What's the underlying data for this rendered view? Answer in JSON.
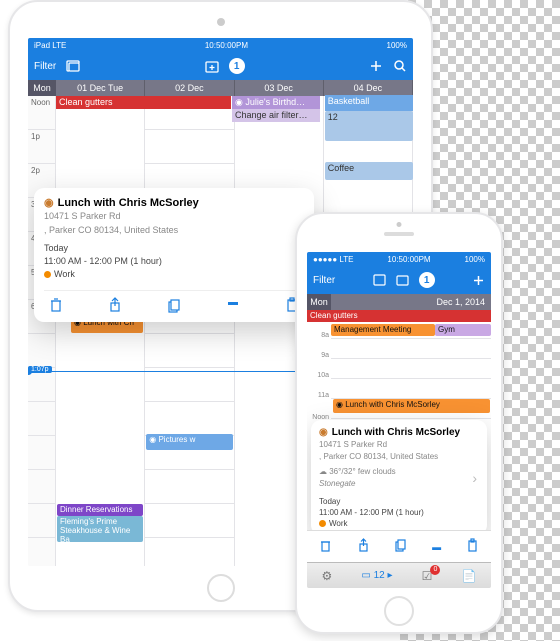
{
  "ipad": {
    "status": {
      "carrier": "iPad LTE",
      "time": "10:50:00PM",
      "battery": "100%"
    },
    "toolbar": {
      "filter": "Filter",
      "badge": "1"
    },
    "days": {
      "mon": "Mon",
      "cols": [
        "01 Dec Tue",
        "02 Dec",
        "03 Dec",
        "04 Dec"
      ]
    },
    "hours": [
      "Noon",
      "1p",
      "2p",
      "3p",
      "4p",
      "5p",
      "6p",
      "",
      "",
      "",
      "",
      "",
      "",
      "",
      ""
    ],
    "nowTime": "1:07p",
    "events": {
      "clean": "Clean gutters",
      "julie": "◉ Julie's Birthd…",
      "filter": "Change air filter…",
      "bball": "Basketball",
      "coffee": "Coffee",
      "lunch": "◉ Lunch with Ch",
      "pictures": "◉ Pictures w",
      "dinner": "Dinner Reservations",
      "fleming": "Fleming's Prime Steakhouse & Wine Ba"
    },
    "popover": {
      "icon": "◉",
      "title": "Lunch with Chris McSorley",
      "addr1": "10471 S Parker Rd",
      "addr2": ", Parker CO 80134, United States",
      "today": "Today",
      "time": "11:00 AM - 12:00 PM  (1 hour)",
      "calendar": "Work"
    }
  },
  "iphone": {
    "status": {
      "carrier": "●●●●● LTE",
      "time": "10:50:00PM",
      "battery": "100%"
    },
    "toolbar": {
      "filter": "Filter",
      "badge": "1"
    },
    "day": {
      "mon": "Mon",
      "date": "Dec 1, 2014"
    },
    "hours": [
      "8a",
      "9a",
      "10a",
      "11a",
      "Noon"
    ],
    "events": {
      "clean": "Clean gutters",
      "mgmt": "Management Meeting",
      "gym": "Gym",
      "lunch": "◉ Lunch with Chris McSorley"
    },
    "popover": {
      "icon": "◉",
      "title": "Lunch with Chris McSorley",
      "addr1": "10471 S Parker Rd",
      "addr2": ", Parker CO 80134, United States",
      "weather": "☁ 36°/32°  few clouds",
      "store": "Stonegate",
      "today": "Today",
      "time": "11:00 AM - 12:00 PM  (1 hour)",
      "calendar": "Work"
    },
    "tabbar": {
      "count": "12",
      "badge": "0"
    }
  }
}
